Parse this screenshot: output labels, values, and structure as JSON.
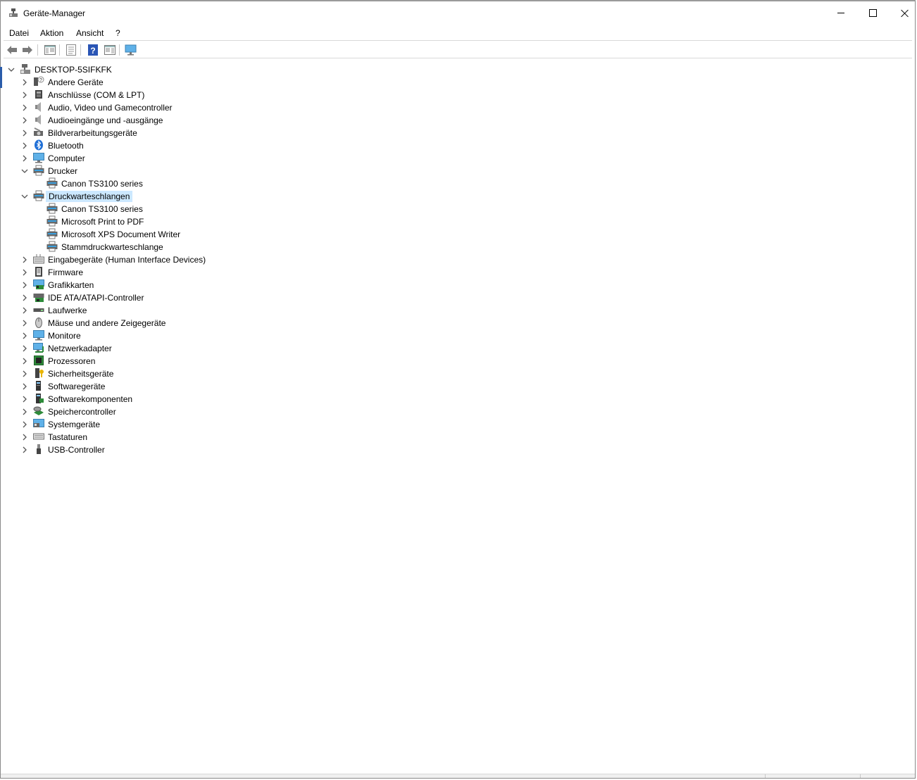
{
  "window": {
    "title": "Geräte-Manager"
  },
  "menu": {
    "items": [
      "Datei",
      "Aktion",
      "Ansicht",
      "?"
    ]
  },
  "toolbar": {
    "buttons": [
      "back-arrow-icon",
      "forward-arrow-icon",
      "show-hide-console-tree-icon",
      "properties-icon",
      "help-icon",
      "action-pane-icon",
      "scan-hardware-icon"
    ]
  },
  "tree": {
    "root": "DESKTOP-5SIFKFK",
    "items": [
      {
        "label": "Andere Geräte",
        "icon": "unknown-device-icon",
        "expanded": false
      },
      {
        "label": "Anschlüsse (COM & LPT)",
        "icon": "port-icon",
        "expanded": false
      },
      {
        "label": "Audio, Video und Gamecontroller",
        "icon": "speaker-icon",
        "expanded": false
      },
      {
        "label": "Audioeingänge und -ausgänge",
        "icon": "speaker-icon",
        "expanded": false
      },
      {
        "label": "Bildverarbeitungsgeräte",
        "icon": "camera-icon",
        "expanded": false
      },
      {
        "label": "Bluetooth",
        "icon": "bluetooth-icon",
        "expanded": false
      },
      {
        "label": "Computer",
        "icon": "monitor-icon",
        "expanded": false
      },
      {
        "label": "Drucker",
        "icon": "printer-icon",
        "expanded": true,
        "children": [
          "Canon TS3100 series"
        ]
      },
      {
        "label": "Druckwarteschlangen",
        "icon": "printer-icon",
        "expanded": true,
        "selected": true,
        "children": [
          "Canon TS3100 series",
          "Microsoft Print to PDF",
          "Microsoft XPS Document Writer",
          "Stammdruckwarteschlange"
        ]
      },
      {
        "label": "Eingabegeräte (Human Interface Devices)",
        "icon": "hid-icon",
        "expanded": false
      },
      {
        "label": "Firmware",
        "icon": "firmware-icon",
        "expanded": false
      },
      {
        "label": "Grafikkarten",
        "icon": "display-adapter-icon",
        "expanded": false
      },
      {
        "label": "IDE ATA/ATAPI-Controller",
        "icon": "ide-controller-icon",
        "expanded": false
      },
      {
        "label": "Laufwerke",
        "icon": "disk-drive-icon",
        "expanded": false
      },
      {
        "label": "Mäuse und andere Zeigegeräte",
        "icon": "mouse-icon",
        "expanded": false
      },
      {
        "label": "Monitore",
        "icon": "monitor-icon",
        "expanded": false
      },
      {
        "label": "Netzwerkadapter",
        "icon": "network-adapter-icon",
        "expanded": false
      },
      {
        "label": "Prozessoren",
        "icon": "processor-icon",
        "expanded": false
      },
      {
        "label": "Sicherheitsgeräte",
        "icon": "security-key-icon",
        "expanded": false
      },
      {
        "label": "Softwaregeräte",
        "icon": "software-device-icon",
        "expanded": false
      },
      {
        "label": "Softwarekomponenten",
        "icon": "software-component-icon",
        "expanded": false
      },
      {
        "label": "Speichercontroller",
        "icon": "storage-controller-icon",
        "expanded": false
      },
      {
        "label": "Systemgeräte",
        "icon": "system-device-icon",
        "expanded": false
      },
      {
        "label": "Tastaturen",
        "icon": "keyboard-icon",
        "expanded": false
      },
      {
        "label": "USB-Controller",
        "icon": "usb-icon",
        "expanded": false
      }
    ]
  },
  "colors": {
    "selection": "#cce8ff",
    "accent": "#2a5caa"
  }
}
